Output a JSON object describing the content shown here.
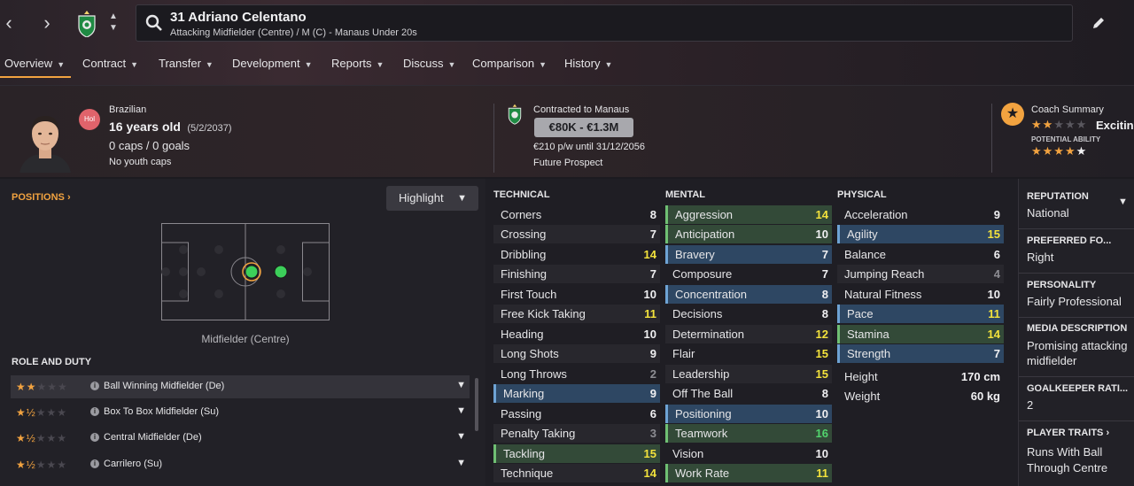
{
  "header": {
    "player_name": "31 Adriano Celentano",
    "subtitle": "Attacking Midfielder (Centre) / M (C) - Manaus Under 20s"
  },
  "tabs": [
    {
      "label": "Overview"
    },
    {
      "label": "Contract"
    },
    {
      "label": "Transfer"
    },
    {
      "label": "Development"
    },
    {
      "label": "Reports"
    },
    {
      "label": "Discuss"
    },
    {
      "label": "Comparison"
    },
    {
      "label": "History"
    }
  ],
  "info": {
    "badge": "Hol",
    "nationality": "Brazilian",
    "age": "16 years old",
    "dob": "(5/2/2037)",
    "caps": "0 caps / 0 goals",
    "youth_caps": "No youth caps",
    "contract_label": "Contracted to Manaus",
    "value": "€80K - €1.3M",
    "wage": "€210 p/w until 31/12/2056",
    "status": "Future Prospect",
    "coach_summary": "Coach Summary",
    "coach_word": "Excitin",
    "potential_label": "POTENTIAL ABILITY",
    "current_stars": 2,
    "potential_stars": 5
  },
  "positions": {
    "title": "POSITIONS",
    "highlight_label": "Highlight",
    "position_name": "Midfielder (Centre)"
  },
  "roles": {
    "title": "ROLE AND DUTY",
    "items": [
      {
        "name": "Ball Winning Midfielder (De)",
        "stars": 2
      },
      {
        "name": "Box To Box Midfielder (Su)",
        "stars": 1.5
      },
      {
        "name": "Central Midfielder (De)",
        "stars": 1.5
      },
      {
        "name": "Carrilero (Su)",
        "stars": 1.5
      }
    ]
  },
  "attributes": {
    "technical_title": "TECHNICAL",
    "mental_title": "MENTAL",
    "physical_title": "PHYSICAL",
    "technical": [
      {
        "name": "Corners",
        "value": "8"
      },
      {
        "name": "Crossing",
        "value": "7"
      },
      {
        "name": "Dribbling",
        "value": "14"
      },
      {
        "name": "Finishing",
        "value": "7"
      },
      {
        "name": "First Touch",
        "value": "10"
      },
      {
        "name": "Free Kick Taking",
        "value": "11"
      },
      {
        "name": "Heading",
        "value": "10"
      },
      {
        "name": "Long Shots",
        "value": "9"
      },
      {
        "name": "Long Throws",
        "value": "2"
      },
      {
        "name": "Marking",
        "value": "9"
      },
      {
        "name": "Passing",
        "value": "6"
      },
      {
        "name": "Penalty Taking",
        "value": "3"
      },
      {
        "name": "Tackling",
        "value": "15"
      },
      {
        "name": "Technique",
        "value": "14"
      }
    ],
    "mental": [
      {
        "name": "Aggression",
        "value": "14"
      },
      {
        "name": "Anticipation",
        "value": "10"
      },
      {
        "name": "Bravery",
        "value": "7"
      },
      {
        "name": "Composure",
        "value": "7"
      },
      {
        "name": "Concentration",
        "value": "8"
      },
      {
        "name": "Decisions",
        "value": "8"
      },
      {
        "name": "Determination",
        "value": "12"
      },
      {
        "name": "Flair",
        "value": "15"
      },
      {
        "name": "Leadership",
        "value": "15"
      },
      {
        "name": "Off The Ball",
        "value": "8"
      },
      {
        "name": "Positioning",
        "value": "10"
      },
      {
        "name": "Teamwork",
        "value": "16"
      },
      {
        "name": "Vision",
        "value": "10"
      },
      {
        "name": "Work Rate",
        "value": "11"
      }
    ],
    "physical": [
      {
        "name": "Acceleration",
        "value": "9"
      },
      {
        "name": "Agility",
        "value": "15"
      },
      {
        "name": "Balance",
        "value": "6"
      },
      {
        "name": "Jumping Reach",
        "value": "4"
      },
      {
        "name": "Natural Fitness",
        "value": "10"
      },
      {
        "name": "Pace",
        "value": "11"
      },
      {
        "name": "Stamina",
        "value": "14"
      },
      {
        "name": "Strength",
        "value": "7"
      }
    ],
    "height_label": "Height",
    "height_value": "170 cm",
    "weight_label": "Weight",
    "weight_value": "60 kg"
  },
  "sidebar": {
    "reputation_title": "REPUTATION",
    "reputation_value": "National",
    "foot_title": "PREFERRED FO...",
    "foot_value": "Right",
    "personality_title": "PERSONALITY",
    "personality_value": "Fairly Professional",
    "media_title": "MEDIA DESCRIPTION",
    "media_value_1": "Promising attacking",
    "media_value_2": "midfielder",
    "gk_title": "GOALKEEPER RATI...",
    "gk_value": "2",
    "traits_title": "PLAYER TRAITS",
    "traits_value_1": "Runs With Ball",
    "traits_value_2": "Through Centre"
  },
  "colors": {
    "accent": "#f2a340",
    "highlight_blue": "#2e4763",
    "highlight_green": "#334a38",
    "value_yellow": "#f3e23c",
    "value_green": "#52d46d"
  }
}
